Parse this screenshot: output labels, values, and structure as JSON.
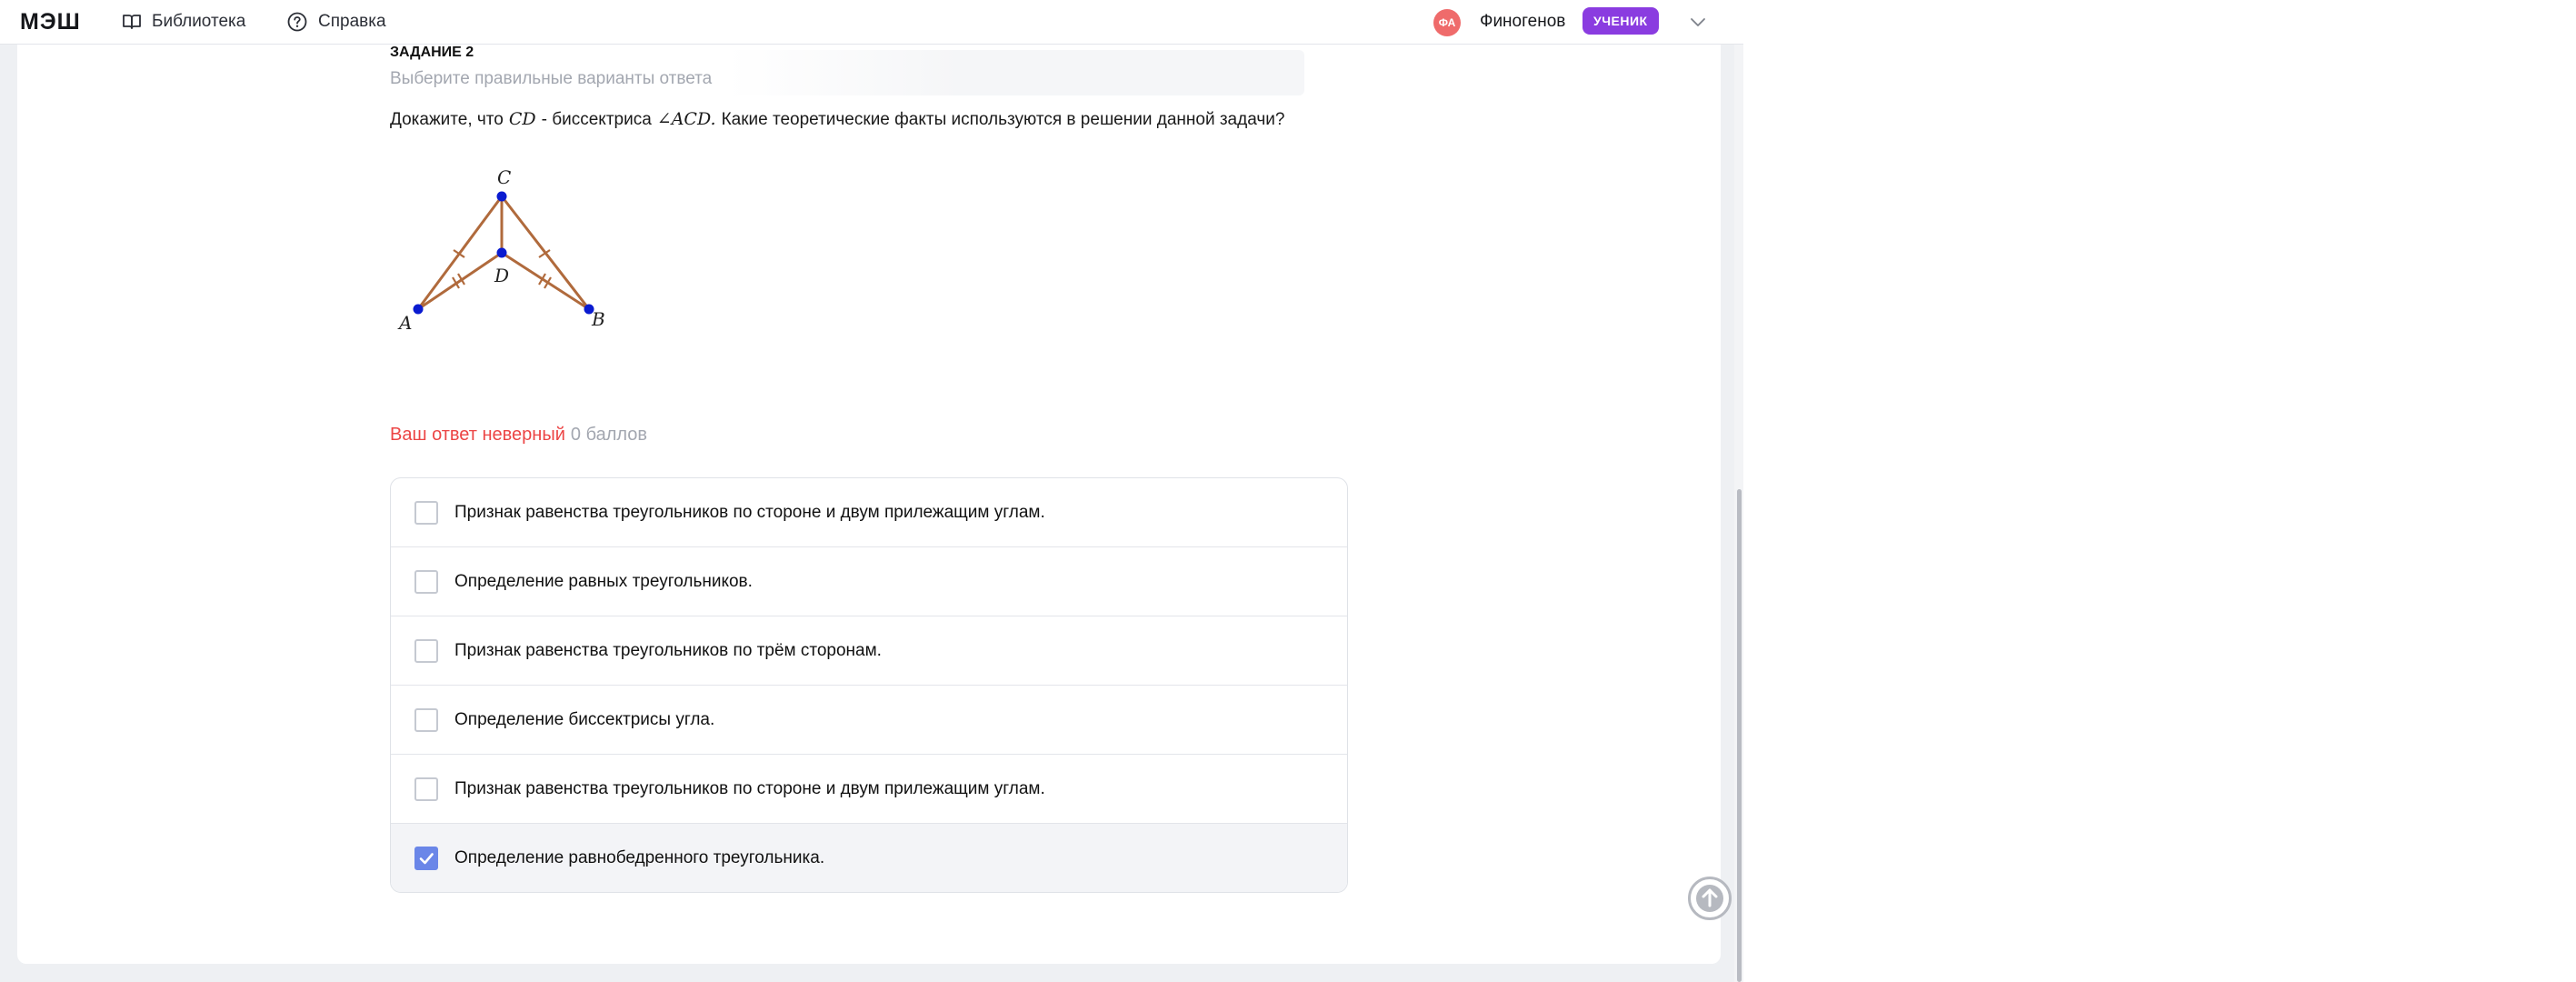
{
  "header": {
    "logo": "МЭШ",
    "nav": [
      {
        "label": "Библиотека",
        "icon": "book-icon"
      },
      {
        "label": "Справка",
        "icon": "help-icon"
      }
    ],
    "user": {
      "initials": "ФА",
      "name": "Финогенов",
      "role": "УЧЕНИК"
    }
  },
  "task": {
    "title": "ЗАДАНИЕ 2",
    "subtitle": "Выберите правильные варианты ответа",
    "question_prefix": "Докажите, что",
    "question_math1": "CD",
    "question_mid": "- биссектриса",
    "question_math2": "∠ACD.",
    "question_suffix": "Какие теоретические факты используются в решении данной задачи?",
    "figure_labels": {
      "a": "A",
      "b": "B",
      "c": "C",
      "d": "D"
    }
  },
  "result": {
    "status": "Ваш ответ неверный",
    "score": "0 баллов"
  },
  "options": [
    {
      "label": "Признак равенства треугольников по стороне и двум прилежащим углам.",
      "checked": false
    },
    {
      "label": "Определение равных треугольников.",
      "checked": false
    },
    {
      "label": "Признак равенства треугольников по трём сторонам.",
      "checked": false
    },
    {
      "label": "Определение биссектрисы угла.",
      "checked": false
    },
    {
      "label": "Признак равенства треугольников по стороне и двум прилежащим углам.",
      "checked": false
    },
    {
      "label": "Определение равнобедренного треугольника.",
      "checked": true
    }
  ],
  "colors": {
    "accent": "#8a3ce0",
    "error": "#ec4545",
    "checkbox_checked": "#6a86e8",
    "figure_line": "#b06a3c",
    "figure_point": "#0a1bd0"
  },
  "icons": {
    "scroll_top": "arrow-up-icon",
    "menu": "chevron-down-icon"
  }
}
